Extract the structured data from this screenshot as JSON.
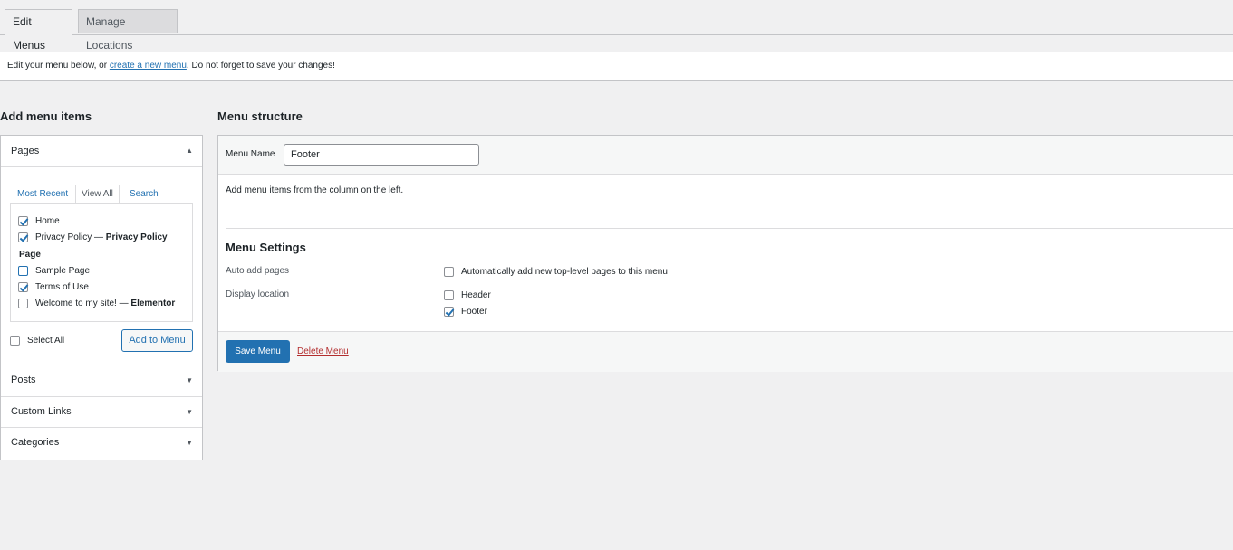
{
  "tabs": [
    {
      "label": "Edit Menus",
      "active": true
    },
    {
      "label": "Manage Locations",
      "active": false
    }
  ],
  "notice": {
    "before": "Edit your menu below, or ",
    "link": "create a new menu",
    "after": ". Do not forget to save your changes!"
  },
  "left": {
    "title": "Add menu items",
    "pages": {
      "label": "Pages",
      "arrow": "▲",
      "tabs": [
        "Most Recent",
        "View All",
        "Search"
      ],
      "items": [
        {
          "label": "Home",
          "suffix": "",
          "checked": true
        },
        {
          "label": "Privacy Policy — ",
          "suffix": "Privacy Policy",
          "checked": true
        },
        {
          "label": "Sample Page",
          "suffix": "",
          "checked": false
        },
        {
          "label": "Terms of Use",
          "suffix": "",
          "checked": true
        },
        {
          "label": "Welcome to my site! — ",
          "suffix": "Elementor",
          "checked": false
        }
      ],
      "group_label": "Page",
      "select_all": "Select All",
      "add_button": "Add to Menu"
    },
    "sections": [
      {
        "label": "Posts",
        "arrow": "▼"
      },
      {
        "label": "Custom Links",
        "arrow": "▼"
      },
      {
        "label": "Categories",
        "arrow": "▼"
      }
    ]
  },
  "right": {
    "title": "Menu structure",
    "menu_name_label": "Menu Name",
    "menu_name_value": "Footer",
    "hint": "Add menu items from the column on the left.",
    "settings_title": "Menu Settings",
    "auto_add_label": "Auto add pages",
    "auto_add_option": "Automatically add new top-level pages to this menu",
    "display_location_label": "Display location",
    "locations": [
      {
        "label": "Header",
        "checked": false
      },
      {
        "label": "Footer",
        "checked": true
      }
    ],
    "save_button": "Save Menu",
    "delete_link": "Delete Menu"
  }
}
